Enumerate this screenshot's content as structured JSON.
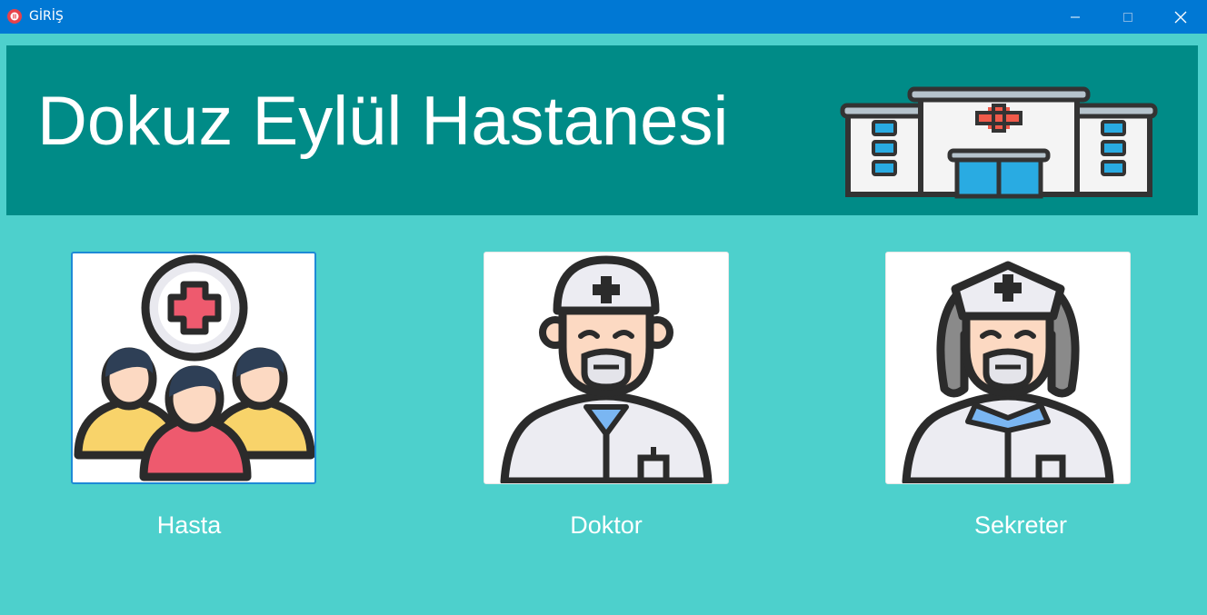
{
  "window": {
    "title": "GİRİŞ",
    "app_icon": "app-icon",
    "controls": [
      "minimize-icon",
      "maximize-icon",
      "close-icon"
    ]
  },
  "header": {
    "title": "Dokuz Eylül Hastanesi",
    "icon": "hospital-icon"
  },
  "roles": [
    {
      "label": "Hasta",
      "icon": "patients-icon"
    },
    {
      "label": "Doktor",
      "icon": "doctor-icon"
    },
    {
      "label": "Sekreter",
      "icon": "secretary-icon"
    }
  ],
  "colors": {
    "titlebar": "#0078d4",
    "background": "#4dd0cc",
    "header": "#008b87",
    "focus_border": "#1e8ad6"
  }
}
